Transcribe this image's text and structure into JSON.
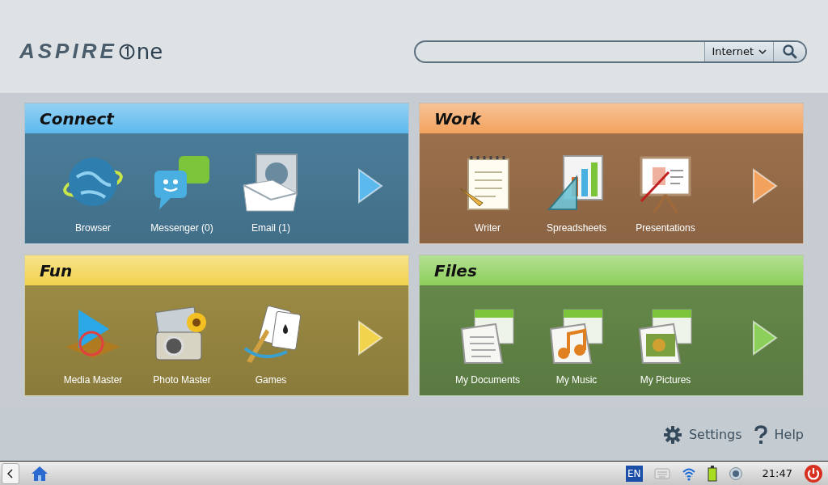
{
  "logo": {
    "brand": "ASPIRE",
    "model": "ne"
  },
  "search": {
    "scope": "Internet"
  },
  "panels": [
    {
      "title": "Connect",
      "color": "#5cb9ee",
      "items": [
        {
          "label": "Browser"
        },
        {
          "label": "Messenger (0)"
        },
        {
          "label": "Email (1)"
        }
      ]
    },
    {
      "title": "Work",
      "color": "#f3a25e",
      "items": [
        {
          "label": "Writer"
        },
        {
          "label": "Spreadsheets"
        },
        {
          "label": "Presentations"
        }
      ]
    },
    {
      "title": "Fun",
      "color": "#f2d34e",
      "items": [
        {
          "label": "Media Master"
        },
        {
          "label": "Photo Master"
        },
        {
          "label": "Games"
        }
      ]
    },
    {
      "title": "Files",
      "color": "#8ccf5a",
      "items": [
        {
          "label": "My Documents"
        },
        {
          "label": "My Music"
        },
        {
          "label": "My Pictures"
        }
      ]
    }
  ],
  "footer_links": [
    "Settings",
    "Help"
  ],
  "taskbar": {
    "language": "EN",
    "time": "21:47"
  }
}
